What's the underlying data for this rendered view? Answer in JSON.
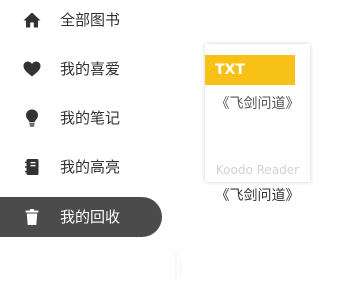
{
  "sidebar": {
    "items": [
      {
        "label": "全部图书",
        "icon": "home-icon"
      },
      {
        "label": "我的喜爱",
        "icon": "heart-icon"
      },
      {
        "label": "我的笔记",
        "icon": "lightbulb-icon"
      },
      {
        "label": "我的高亮",
        "icon": "notebook-icon"
      },
      {
        "label": "我的回收",
        "icon": "trash-icon"
      }
    ],
    "active_index": 4
  },
  "book": {
    "format": "TXT",
    "cover_title": "《飞剑问道》",
    "cover_brand": "Koodo Reader",
    "title": "《飞剑问道》"
  },
  "colors": {
    "active_bg": "#4b4b4b",
    "badge_bg": "#f8c117",
    "icon": "#333333"
  }
}
